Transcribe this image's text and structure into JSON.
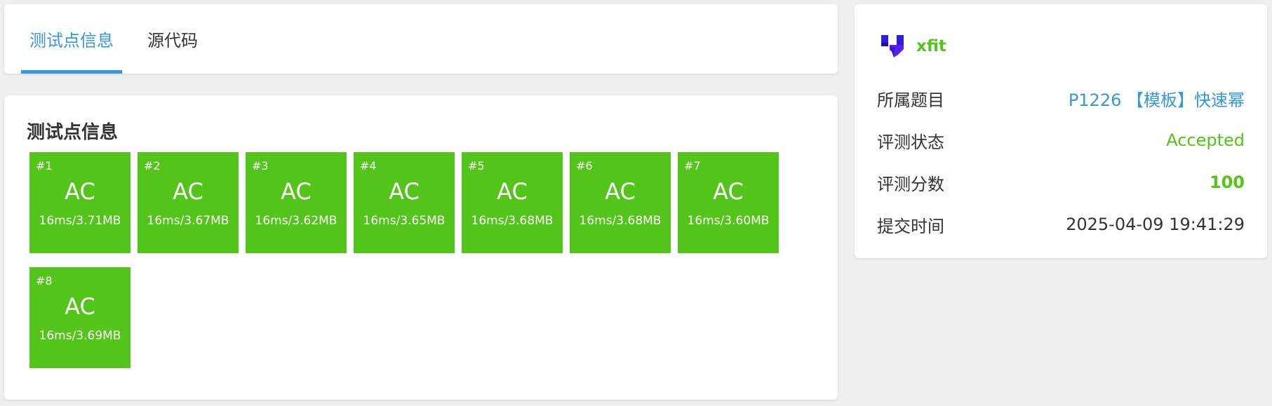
{
  "tabs": [
    {
      "label": "测试点信息",
      "active": true
    },
    {
      "label": "源代码",
      "active": false
    }
  ],
  "cases_section": {
    "title": "测试点信息",
    "cases": [
      {
        "index": "#1",
        "status": "AC",
        "detail": "16ms/3.71MB"
      },
      {
        "index": "#2",
        "status": "AC",
        "detail": "16ms/3.67MB"
      },
      {
        "index": "#3",
        "status": "AC",
        "detail": "16ms/3.62MB"
      },
      {
        "index": "#4",
        "status": "AC",
        "detail": "16ms/3.65MB"
      },
      {
        "index": "#5",
        "status": "AC",
        "detail": "16ms/3.68MB"
      },
      {
        "index": "#6",
        "status": "AC",
        "detail": "16ms/3.68MB"
      },
      {
        "index": "#7",
        "status": "AC",
        "detail": "16ms/3.60MB"
      },
      {
        "index": "#8",
        "status": "AC",
        "detail": "16ms/3.69MB"
      }
    ]
  },
  "info": {
    "user": {
      "name": "xfit",
      "icon": "user-avatar-icon"
    },
    "rows": [
      {
        "label": "所属题目",
        "value": "P1226 【模板】快速幂"
      },
      {
        "label": "评测状态",
        "value": "Accepted"
      },
      {
        "label": "评测分数",
        "value": "100"
      },
      {
        "label": "提交时间",
        "value": "2025-04-09 19:41:29"
      }
    ]
  },
  "colors": {
    "accent": "#3498db",
    "accepted": "#52c41a",
    "background": "#efefef"
  }
}
